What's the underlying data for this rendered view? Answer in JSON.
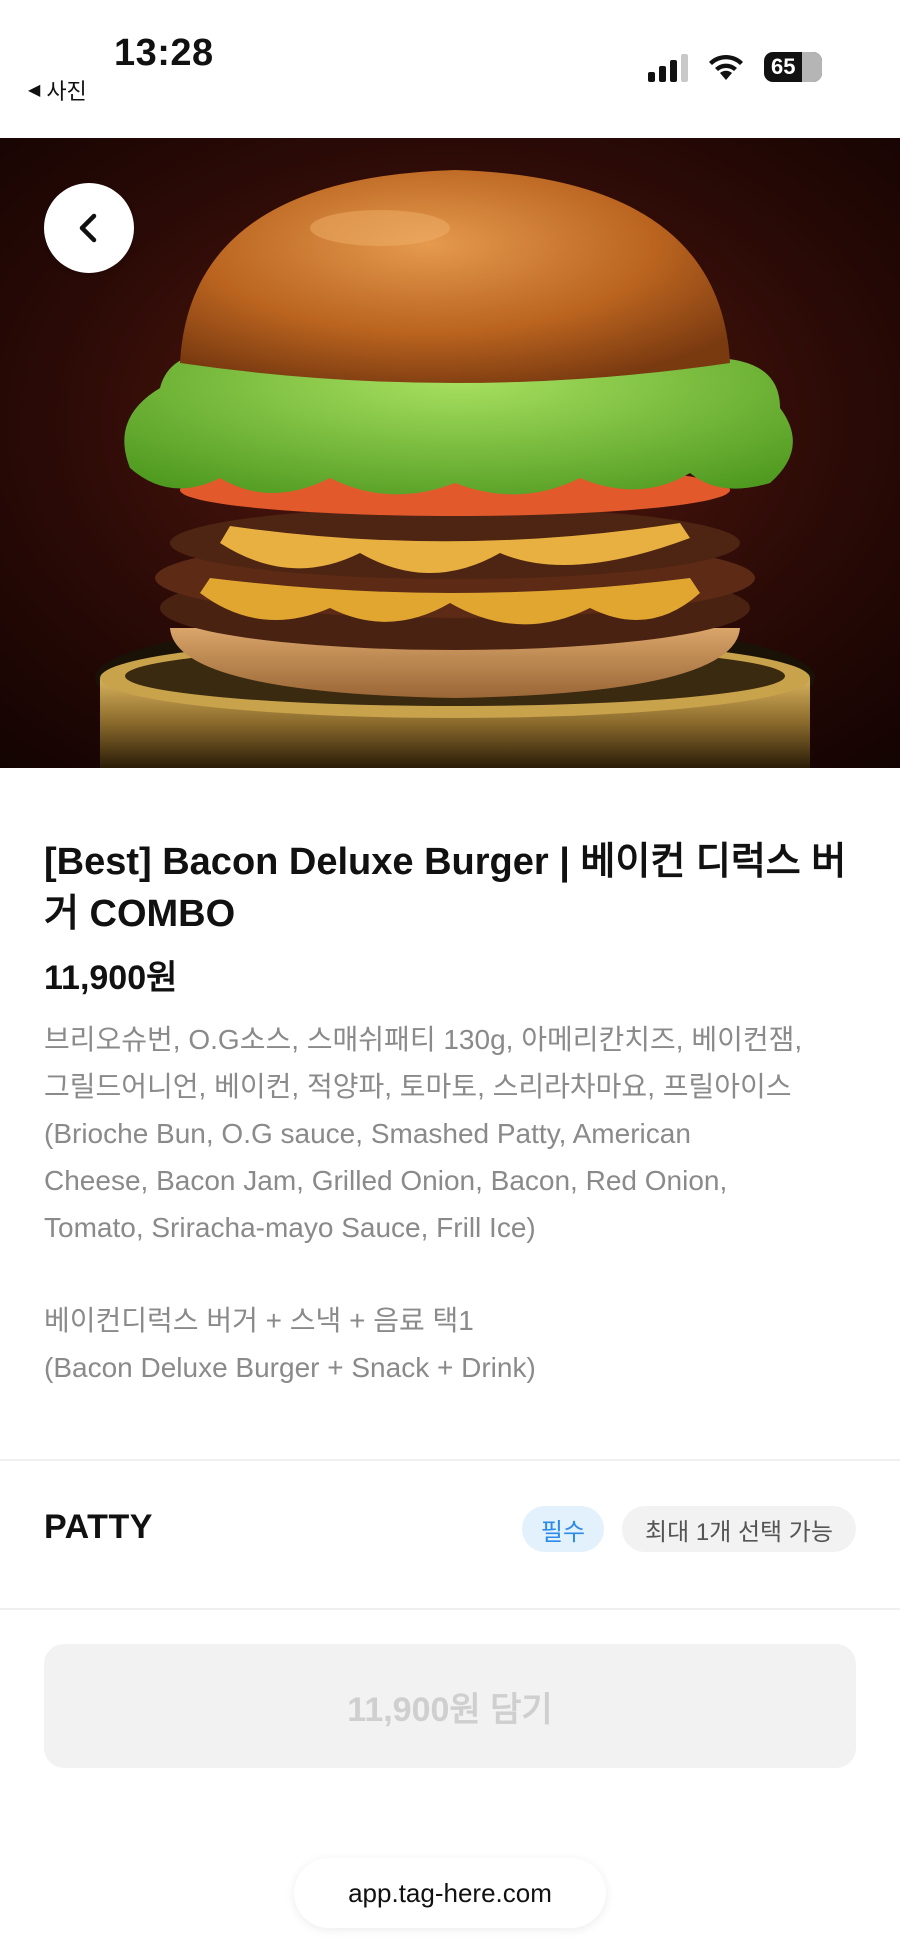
{
  "status_bar": {
    "time": "13:28",
    "back_app_label": "사진",
    "battery_level": "65",
    "icons": [
      "signal-icon",
      "wifi-icon",
      "battery-icon"
    ]
  },
  "hero": {
    "image_subject": "burger-photo",
    "back_icon": "chevron-left-icon"
  },
  "product": {
    "title": "[Best] Bacon Deluxe Burger | 베이컨 디럭스 버거 COMBO",
    "price": "11,900원",
    "ingredients_lines": [
      "브리오슈번, O.G소스, 스매쉬패티 130g, 아메리칸치즈, 베이컨잼,",
      "그릴드어니언, 베이컨, 적양파, 토마토, 스리라차마요, 프릴아이스",
      "(Brioche  Bun, O.G sauce, Smashed Patty, American",
      "Cheese, Bacon Jam, Grilled Onion, Bacon, Red Onion,",
      "Tomato, Sriracha-mayo Sauce, Frill Ice)"
    ],
    "combo_lines": [
      "베이컨디럭스 버거 + 스낵 + 음료 택1",
      "(Bacon Deluxe Burger + Snack + Drink)"
    ]
  },
  "option": {
    "title": "PATTY",
    "required_label": "필수",
    "limit_label": "최대 1개 선택 가능"
  },
  "cart_button": {
    "label": "11,900원 담기"
  },
  "browser": {
    "url": "app.tag-here.com"
  },
  "colors": {
    "accent_blue": "#2a8be8",
    "required_bg": "#e3f1fd",
    "muted_text": "#8a8a8a",
    "disabled_text": "#cfcfcf"
  }
}
